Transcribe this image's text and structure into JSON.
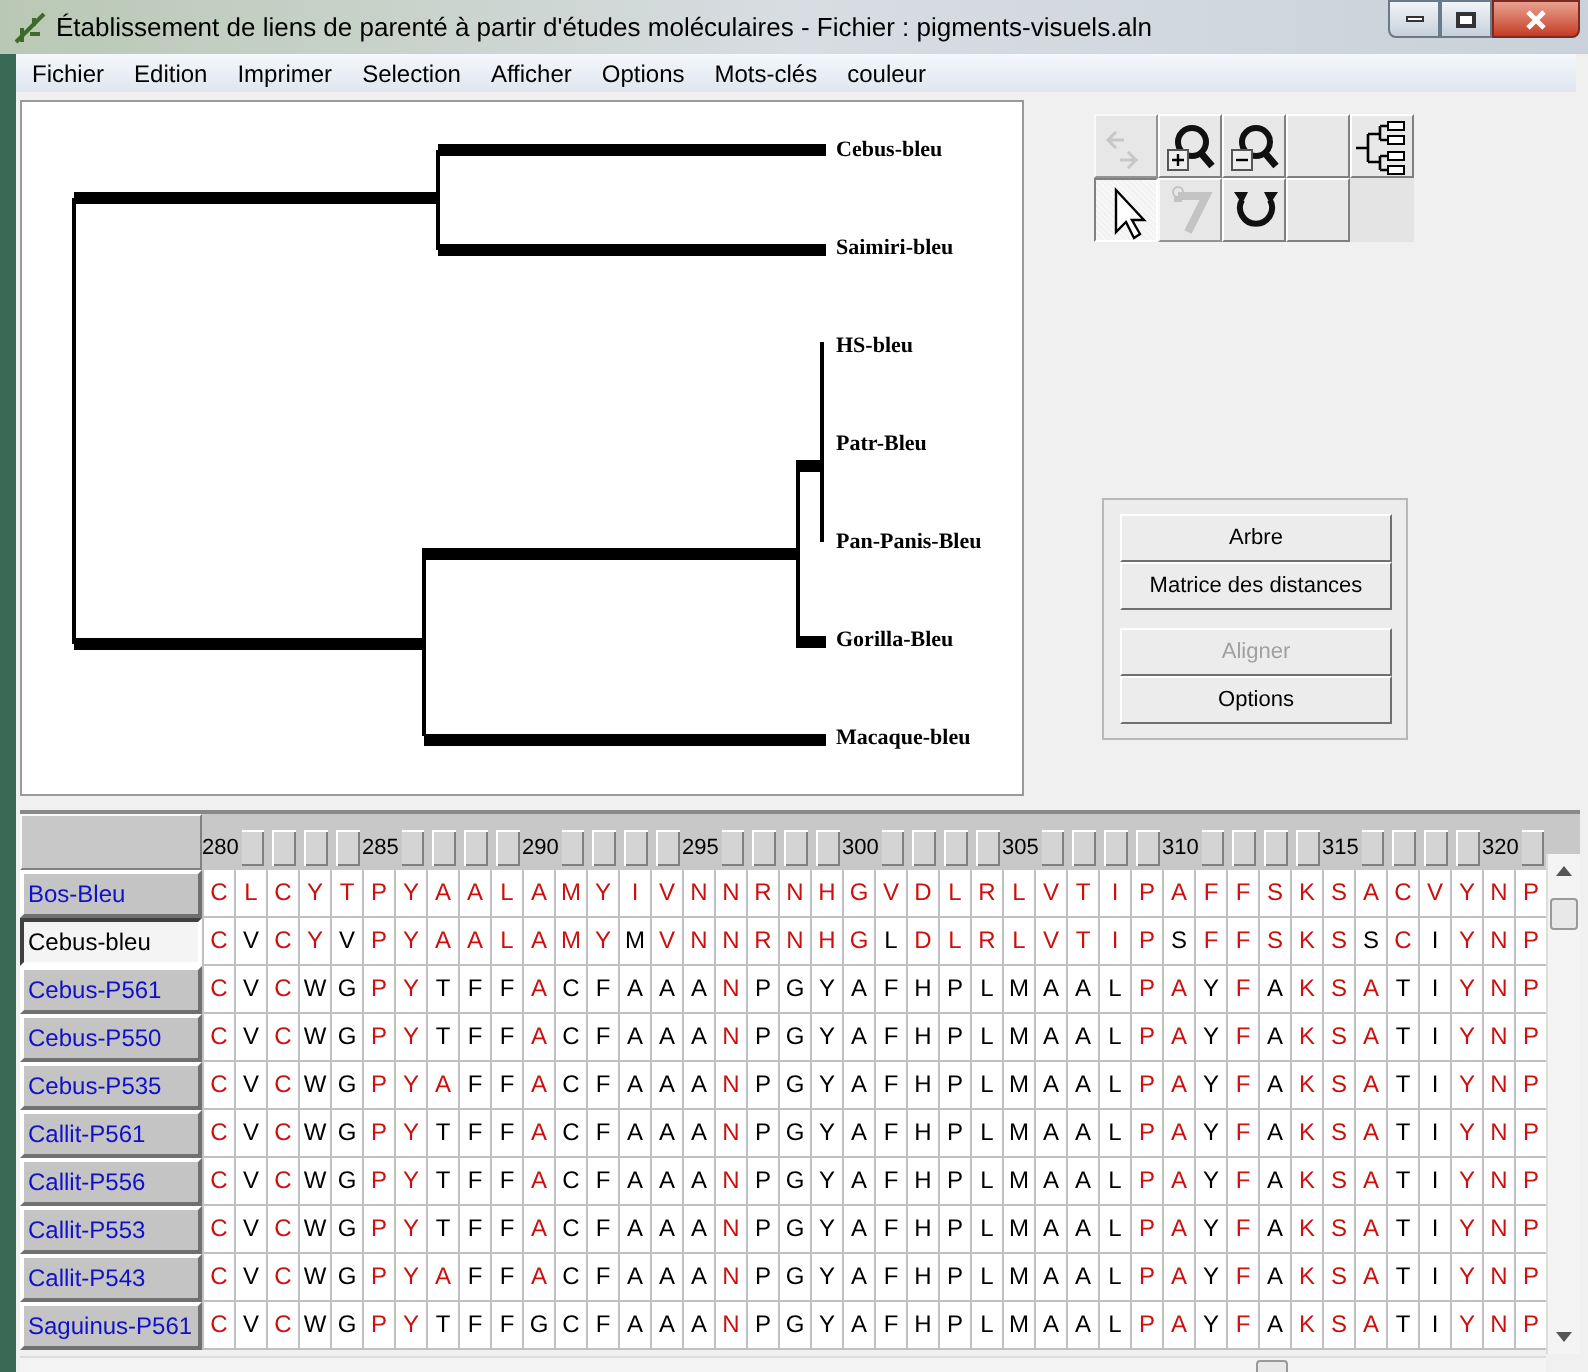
{
  "window": {
    "title": "Établissement de liens de parenté à partir d'études moléculaires - Fichier : pigments-visuels.aln"
  },
  "menu": [
    "Fichier",
    "Edition",
    "Imprimer",
    "Selection",
    "Afficher",
    "Options",
    "Mots-clés",
    "couleur"
  ],
  "tree": {
    "children": [
      {
        "children": [
          {
            "label": "Cebus-bleu"
          },
          {
            "label": "Saimiri-bleu"
          }
        ]
      },
      {
        "children": [
          {
            "children": [
              {
                "children": [
                  {
                    "label": "HS-bleu"
                  },
                  {
                    "label": "Patr-Bleu"
                  },
                  {
                    "label": "Pan-Panis-Bleu"
                  }
                ]
              },
              {
                "label": "Gorilla-Bleu"
              }
            ]
          },
          {
            "label": "Macaque-bleu"
          }
        ]
      }
    ]
  },
  "tools": [
    {
      "kind": "swap",
      "disabled": true,
      "selected": false
    },
    {
      "kind": "zoom-in",
      "disabled": false,
      "selected": false
    },
    {
      "kind": "zoom-out",
      "disabled": false,
      "selected": false
    },
    {
      "kind": "empty",
      "disabled": false,
      "selected": false
    },
    {
      "kind": "tree",
      "disabled": false,
      "selected": false
    },
    {
      "kind": "pointer",
      "disabled": false,
      "selected": true
    },
    {
      "kind": "hook",
      "disabled": true,
      "selected": false
    },
    {
      "kind": "rotate",
      "disabled": false,
      "selected": false
    },
    {
      "kind": "empty",
      "disabled": false,
      "selected": false
    }
  ],
  "buttons": [
    {
      "label": "Arbre",
      "disabled": false
    },
    {
      "label": "Matrice des distances",
      "disabled": false
    },
    {
      "label": "Aligner",
      "disabled": true
    },
    {
      "label": "Options",
      "disabled": false
    }
  ],
  "ruler_labels": [
    "280",
    "285",
    "290",
    "295",
    "300",
    "305",
    "310",
    "315",
    "320"
  ],
  "rows": [
    {
      "name": "Bos-Bleu",
      "selected": false,
      "residues": [
        "C",
        "L",
        "C",
        "Y",
        "T",
        "P",
        "Y",
        "A",
        "A",
        "L",
        "A",
        "M",
        "Y",
        "I",
        "V",
        "N",
        "N",
        "R",
        "N",
        "H",
        "G",
        "V",
        "D",
        "L",
        "R",
        "L",
        "V",
        "T",
        "I",
        "P",
        "A",
        "F",
        "F",
        "S",
        "K",
        "S",
        "A",
        "C",
        "V",
        "Y",
        "N",
        "P"
      ],
      "match": [
        true,
        true,
        true,
        true,
        true,
        true,
        true,
        true,
        true,
        true,
        true,
        true,
        true,
        true,
        true,
        true,
        true,
        true,
        true,
        true,
        true,
        true,
        true,
        true,
        true,
        true,
        true,
        true,
        true,
        true,
        true,
        true,
        true,
        true,
        true,
        true,
        true,
        true,
        true,
        true,
        true,
        true
      ]
    },
    {
      "name": "Cebus-bleu",
      "selected": true,
      "residues": [
        "C",
        "V",
        "C",
        "Y",
        "V",
        "P",
        "Y",
        "A",
        "A",
        "L",
        "A",
        "M",
        "Y",
        "M",
        "V",
        "N",
        "N",
        "R",
        "N",
        "H",
        "G",
        "L",
        "D",
        "L",
        "R",
        "L",
        "V",
        "T",
        "I",
        "P",
        "S",
        "F",
        "F",
        "S",
        "K",
        "S",
        "S",
        "C",
        "I",
        "Y",
        "N",
        "P"
      ],
      "match": [
        true,
        false,
        true,
        true,
        false,
        true,
        true,
        true,
        true,
        true,
        true,
        true,
        true,
        false,
        true,
        true,
        true,
        true,
        true,
        true,
        true,
        false,
        true,
        true,
        true,
        true,
        true,
        true,
        true,
        true,
        false,
        true,
        true,
        true,
        true,
        true,
        false,
        true,
        false,
        true,
        true,
        true
      ]
    },
    {
      "name": "Cebus-P561",
      "selected": false,
      "residues": [
        "C",
        "V",
        "C",
        "W",
        "G",
        "P",
        "Y",
        "T",
        "F",
        "F",
        "A",
        "C",
        "F",
        "A",
        "A",
        "A",
        "N",
        "P",
        "G",
        "Y",
        "A",
        "F",
        "H",
        "P",
        "L",
        "M",
        "A",
        "A",
        "L",
        "P",
        "A",
        "Y",
        "F",
        "A",
        "K",
        "S",
        "A",
        "T",
        "I",
        "Y",
        "N",
        "P"
      ],
      "match": [
        true,
        false,
        true,
        false,
        false,
        true,
        true,
        false,
        false,
        false,
        true,
        false,
        false,
        false,
        false,
        false,
        true,
        false,
        false,
        false,
        false,
        false,
        false,
        false,
        false,
        false,
        false,
        false,
        false,
        true,
        true,
        false,
        true,
        false,
        true,
        true,
        true,
        false,
        false,
        true,
        true,
        true
      ]
    },
    {
      "name": "Cebus-P550",
      "selected": false,
      "residues": [
        "C",
        "V",
        "C",
        "W",
        "G",
        "P",
        "Y",
        "T",
        "F",
        "F",
        "A",
        "C",
        "F",
        "A",
        "A",
        "A",
        "N",
        "P",
        "G",
        "Y",
        "A",
        "F",
        "H",
        "P",
        "L",
        "M",
        "A",
        "A",
        "L",
        "P",
        "A",
        "Y",
        "F",
        "A",
        "K",
        "S",
        "A",
        "T",
        "I",
        "Y",
        "N",
        "P"
      ],
      "match": [
        true,
        false,
        true,
        false,
        false,
        true,
        true,
        false,
        false,
        false,
        true,
        false,
        false,
        false,
        false,
        false,
        true,
        false,
        false,
        false,
        false,
        false,
        false,
        false,
        false,
        false,
        false,
        false,
        false,
        true,
        true,
        false,
        true,
        false,
        true,
        true,
        true,
        false,
        false,
        true,
        true,
        true
      ]
    },
    {
      "name": "Cebus-P535",
      "selected": false,
      "residues": [
        "C",
        "V",
        "C",
        "W",
        "G",
        "P",
        "Y",
        "A",
        "F",
        "F",
        "A",
        "C",
        "F",
        "A",
        "A",
        "A",
        "N",
        "P",
        "G",
        "Y",
        "A",
        "F",
        "H",
        "P",
        "L",
        "M",
        "A",
        "A",
        "L",
        "P",
        "A",
        "Y",
        "F",
        "A",
        "K",
        "S",
        "A",
        "T",
        "I",
        "Y",
        "N",
        "P"
      ],
      "match": [
        true,
        false,
        true,
        false,
        false,
        true,
        true,
        true,
        false,
        false,
        true,
        false,
        false,
        false,
        false,
        false,
        true,
        false,
        false,
        false,
        false,
        false,
        false,
        false,
        false,
        false,
        false,
        false,
        false,
        true,
        true,
        false,
        true,
        false,
        true,
        true,
        true,
        false,
        false,
        true,
        true,
        true
      ]
    },
    {
      "name": "Callit-P561",
      "selected": false,
      "residues": [
        "C",
        "V",
        "C",
        "W",
        "G",
        "P",
        "Y",
        "T",
        "F",
        "F",
        "A",
        "C",
        "F",
        "A",
        "A",
        "A",
        "N",
        "P",
        "G",
        "Y",
        "A",
        "F",
        "H",
        "P",
        "L",
        "M",
        "A",
        "A",
        "L",
        "P",
        "A",
        "Y",
        "F",
        "A",
        "K",
        "S",
        "A",
        "T",
        "I",
        "Y",
        "N",
        "P"
      ],
      "match": [
        true,
        false,
        true,
        false,
        false,
        true,
        true,
        false,
        false,
        false,
        true,
        false,
        false,
        false,
        false,
        false,
        true,
        false,
        false,
        false,
        false,
        false,
        false,
        false,
        false,
        false,
        false,
        false,
        false,
        true,
        true,
        false,
        true,
        false,
        true,
        true,
        true,
        false,
        false,
        true,
        true,
        true
      ]
    },
    {
      "name": "Callit-P556",
      "selected": false,
      "residues": [
        "C",
        "V",
        "C",
        "W",
        "G",
        "P",
        "Y",
        "T",
        "F",
        "F",
        "A",
        "C",
        "F",
        "A",
        "A",
        "A",
        "N",
        "P",
        "G",
        "Y",
        "A",
        "F",
        "H",
        "P",
        "L",
        "M",
        "A",
        "A",
        "L",
        "P",
        "A",
        "Y",
        "F",
        "A",
        "K",
        "S",
        "A",
        "T",
        "I",
        "Y",
        "N",
        "P"
      ],
      "match": [
        true,
        false,
        true,
        false,
        false,
        true,
        true,
        false,
        false,
        false,
        true,
        false,
        false,
        false,
        false,
        false,
        true,
        false,
        false,
        false,
        false,
        false,
        false,
        false,
        false,
        false,
        false,
        false,
        false,
        true,
        true,
        false,
        true,
        false,
        true,
        true,
        true,
        false,
        false,
        true,
        true,
        true
      ]
    },
    {
      "name": "Callit-P553",
      "selected": false,
      "residues": [
        "C",
        "V",
        "C",
        "W",
        "G",
        "P",
        "Y",
        "T",
        "F",
        "F",
        "A",
        "C",
        "F",
        "A",
        "A",
        "A",
        "N",
        "P",
        "G",
        "Y",
        "A",
        "F",
        "H",
        "P",
        "L",
        "M",
        "A",
        "A",
        "L",
        "P",
        "A",
        "Y",
        "F",
        "A",
        "K",
        "S",
        "A",
        "T",
        "I",
        "Y",
        "N",
        "P"
      ],
      "match": [
        true,
        false,
        true,
        false,
        false,
        true,
        true,
        false,
        false,
        false,
        true,
        false,
        false,
        false,
        false,
        false,
        true,
        false,
        false,
        false,
        false,
        false,
        false,
        false,
        false,
        false,
        false,
        false,
        false,
        true,
        true,
        false,
        true,
        false,
        true,
        true,
        true,
        false,
        false,
        true,
        true,
        true
      ]
    },
    {
      "name": "Callit-P543",
      "selected": false,
      "residues": [
        "C",
        "V",
        "C",
        "W",
        "G",
        "P",
        "Y",
        "A",
        "F",
        "F",
        "A",
        "C",
        "F",
        "A",
        "A",
        "A",
        "N",
        "P",
        "G",
        "Y",
        "A",
        "F",
        "H",
        "P",
        "L",
        "M",
        "A",
        "A",
        "L",
        "P",
        "A",
        "Y",
        "F",
        "A",
        "K",
        "S",
        "A",
        "T",
        "I",
        "Y",
        "N",
        "P"
      ],
      "match": [
        true,
        false,
        true,
        false,
        false,
        true,
        true,
        true,
        false,
        false,
        true,
        false,
        false,
        false,
        false,
        false,
        true,
        false,
        false,
        false,
        false,
        false,
        false,
        false,
        false,
        false,
        false,
        false,
        false,
        true,
        true,
        false,
        true,
        false,
        true,
        true,
        true,
        false,
        false,
        true,
        true,
        true
      ]
    },
    {
      "name": "Saguinus-P561",
      "selected": false,
      "residues": [
        "C",
        "V",
        "C",
        "W",
        "G",
        "P",
        "Y",
        "T",
        "F",
        "F",
        "G",
        "C",
        "F",
        "A",
        "A",
        "A",
        "N",
        "P",
        "G",
        "Y",
        "A",
        "F",
        "H",
        "P",
        "L",
        "M",
        "A",
        "A",
        "L",
        "P",
        "A",
        "Y",
        "F",
        "A",
        "K",
        "S",
        "A",
        "T",
        "I",
        "Y",
        "N",
        "P"
      ],
      "match": [
        true,
        false,
        true,
        false,
        false,
        true,
        true,
        false,
        false,
        false,
        false,
        false,
        false,
        false,
        false,
        false,
        true,
        false,
        false,
        false,
        false,
        false,
        false,
        false,
        false,
        false,
        false,
        false,
        false,
        true,
        true,
        false,
        true,
        false,
        true,
        true,
        true,
        false,
        false,
        true,
        true,
        true
      ]
    }
  ]
}
